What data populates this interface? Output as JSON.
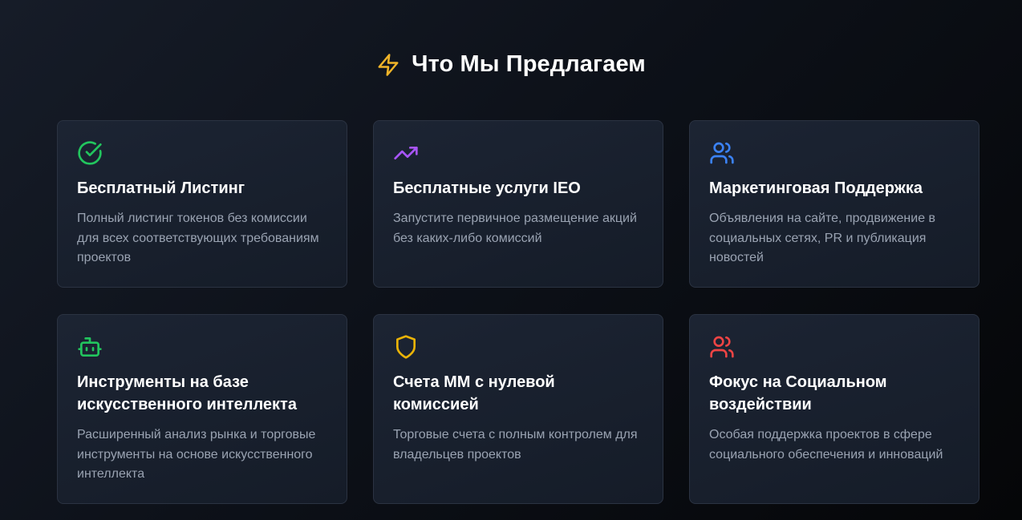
{
  "section": {
    "title": "Что Мы Предлагаем",
    "icon": "lightning-bolt-icon",
    "icon_color": "#f0b429"
  },
  "cards": [
    {
      "icon": "check-circle-icon",
      "icon_color": "#22c55e",
      "title": "Бесплатный Листинг",
      "description": "Полный листинг токенов без комиссии для всех соответствующих требованиям проектов"
    },
    {
      "icon": "trending-up-icon",
      "icon_color": "#a855f7",
      "title": "Бесплатные услуги IEO",
      "description": "Запустите первичное размещение акций без каких-либо комиссий"
    },
    {
      "icon": "users-icon",
      "icon_color": "#3b82f6",
      "title": "Маркетинговая Поддержка",
      "description": "Объявления на сайте, продвижение в социальных сетях, PR и публикация новостей"
    },
    {
      "icon": "bot-icon",
      "icon_color": "#22c55e",
      "title": "Инструменты на базе искусственного интеллекта",
      "description": "Расширенный анализ рынка и торговые инструменты на основе искусственного интеллекта"
    },
    {
      "icon": "shield-icon",
      "icon_color": "#eab308",
      "title": "Счета ММ с нулевой комиссией",
      "description": "Торговые счета с полным контролем для владельцев проектов"
    },
    {
      "icon": "users-icon",
      "icon_color": "#ef4444",
      "title": "Фокус на Социальном воздействии",
      "description": "Особая поддержка проектов в сфере социального обеспечения и инноваций"
    }
  ]
}
